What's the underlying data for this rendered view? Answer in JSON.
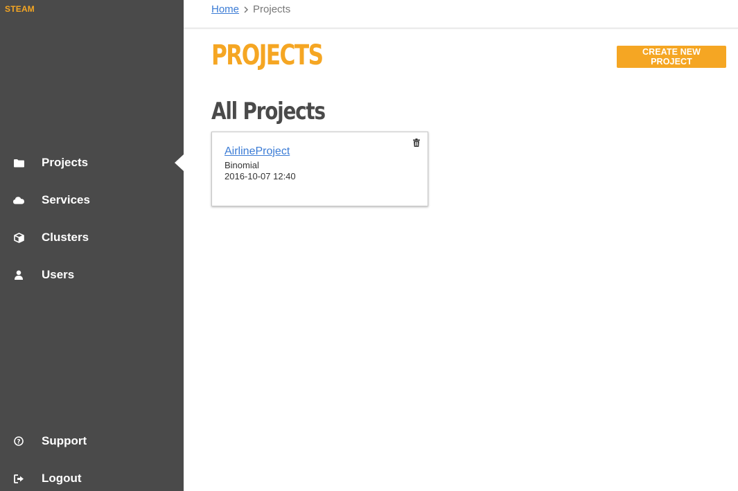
{
  "app": {
    "brand": "STEAM"
  },
  "sidebar": {
    "items": [
      {
        "label": "Projects",
        "icon": "folder-icon",
        "active": true
      },
      {
        "label": "Services",
        "icon": "cloud-icon",
        "active": false
      },
      {
        "label": "Clusters",
        "icon": "cube-icon",
        "active": false
      },
      {
        "label": "Users",
        "icon": "user-icon",
        "active": false
      }
    ],
    "bottom_items": [
      {
        "label": "Support",
        "icon": "question-circle-icon"
      },
      {
        "label": "Logout",
        "icon": "logout-icon"
      }
    ]
  },
  "breadcrumb": {
    "home": "Home",
    "separator_icon": "chevron-right-icon",
    "current": "Projects"
  },
  "main": {
    "page_title": "PROJECTS",
    "create_button": "CREATE NEW PROJECT",
    "section_title": "All Projects",
    "projects": [
      {
        "name": "AirlineProject",
        "type": "Binomial",
        "created": "2016-10-07 12:40",
        "delete_icon": "trash-icon"
      }
    ]
  },
  "colors": {
    "accent": "#f5a623",
    "sidebar_bg": "#4a4a4a",
    "link": "#3a7bd5"
  }
}
